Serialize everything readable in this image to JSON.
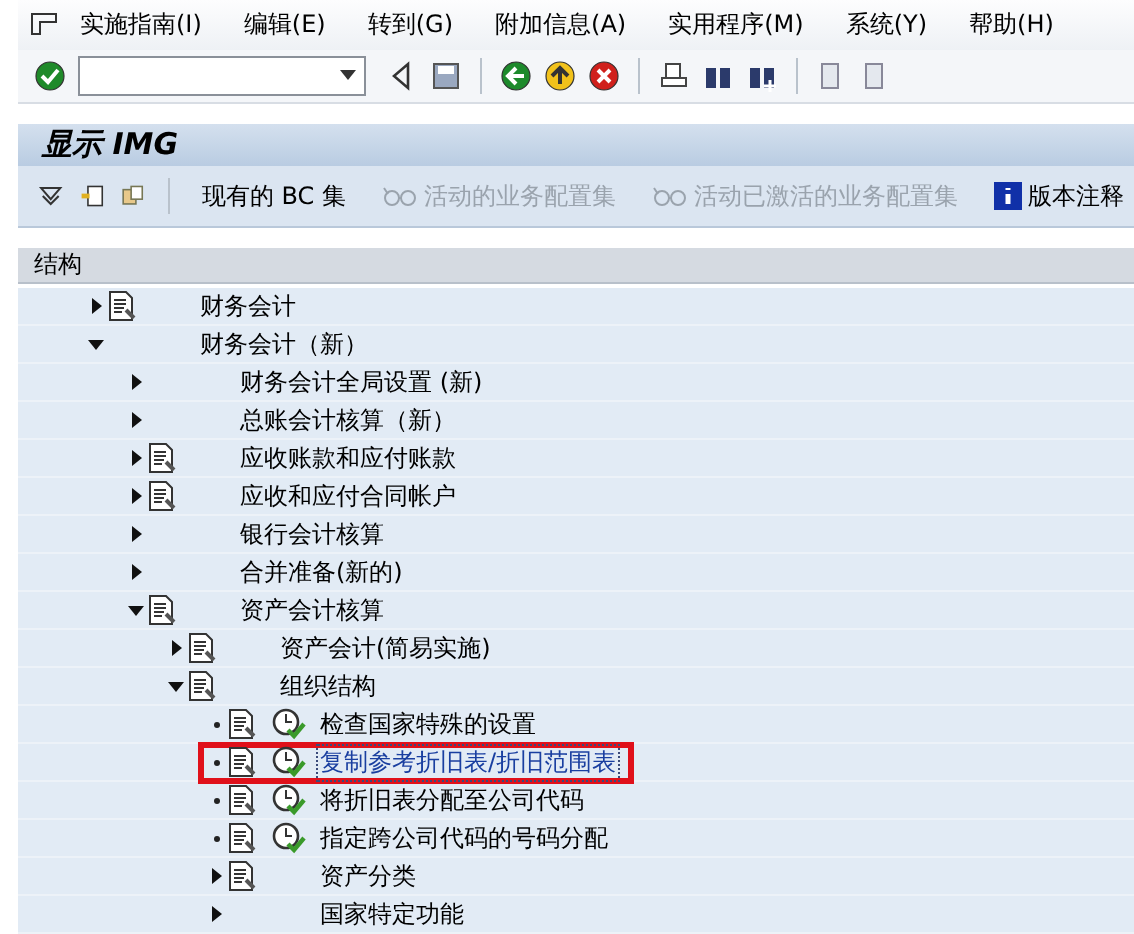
{
  "menu": [
    {
      "label": "实施指南(I)"
    },
    {
      "label": "编辑(E)"
    },
    {
      "label": "转到(G)"
    },
    {
      "label": "附加信息(A)"
    },
    {
      "label": "实用程序(M)"
    },
    {
      "label": "系统(Y)"
    },
    {
      "label": "帮助(H)"
    }
  ],
  "title": "显示 IMG",
  "app_toolbar": [
    {
      "label": "现有的 BC 集",
      "kind": "text",
      "disabled": false
    },
    {
      "label": "活动的业务配置集",
      "kind": "glasses",
      "disabled": true
    },
    {
      "label": "活动已激活的业务配置集",
      "kind": "glasses",
      "disabled": true
    },
    {
      "label": "版本注释",
      "kind": "info",
      "disabled": false
    }
  ],
  "tree_header": "结构",
  "tree": [
    {
      "label": "财务会计",
      "kind": "node",
      "expanded": false,
      "doc": true,
      "selected": false
    },
    {
      "label": "财务会计（新）",
      "kind": "node",
      "expanded": true,
      "doc": false,
      "selected": false,
      "children": [
        {
          "label": "财务会计全局设置 (新)",
          "kind": "node",
          "expanded": false,
          "doc": false,
          "selected": false
        },
        {
          "label": "总账会计核算（新）",
          "kind": "node",
          "expanded": false,
          "doc": false,
          "selected": false
        },
        {
          "label": "应收账款和应付账款",
          "kind": "node",
          "expanded": false,
          "doc": true,
          "selected": false
        },
        {
          "label": "应收和应付合同帐户",
          "kind": "node",
          "expanded": false,
          "doc": true,
          "selected": false
        },
        {
          "label": "银行会计核算",
          "kind": "node",
          "expanded": false,
          "doc": false,
          "selected": false
        },
        {
          "label": "合并准备(新的)",
          "kind": "node",
          "expanded": false,
          "doc": false,
          "selected": false
        },
        {
          "label": "资产会计核算",
          "kind": "node",
          "expanded": true,
          "doc": true,
          "selected": false,
          "children": [
            {
              "label": "资产会计(简易实施)",
              "kind": "node",
              "expanded": false,
              "doc": true,
              "selected": false
            },
            {
              "label": "组织结构",
              "kind": "node",
              "expanded": true,
              "doc": true,
              "selected": false,
              "children": [
                {
                  "label": "检查国家特殊的设置",
                  "kind": "activity",
                  "doc": true,
                  "selected": false
                },
                {
                  "label": "复制参考折旧表/折旧范围表",
                  "kind": "activity",
                  "doc": true,
                  "selected": true
                },
                {
                  "label": "将折旧表分配至公司代码",
                  "kind": "activity",
                  "doc": true,
                  "selected": false
                },
                {
                  "label": "指定跨公司代码的号码分配",
                  "kind": "activity",
                  "doc": true,
                  "selected": false
                },
                {
                  "label": "资产分类",
                  "kind": "node",
                  "expanded": false,
                  "doc": true,
                  "selected": false
                },
                {
                  "label": "国家特定功能",
                  "kind": "node",
                  "expanded": false,
                  "doc": false,
                  "selected": false
                }
              ]
            }
          ]
        }
      ]
    }
  ]
}
